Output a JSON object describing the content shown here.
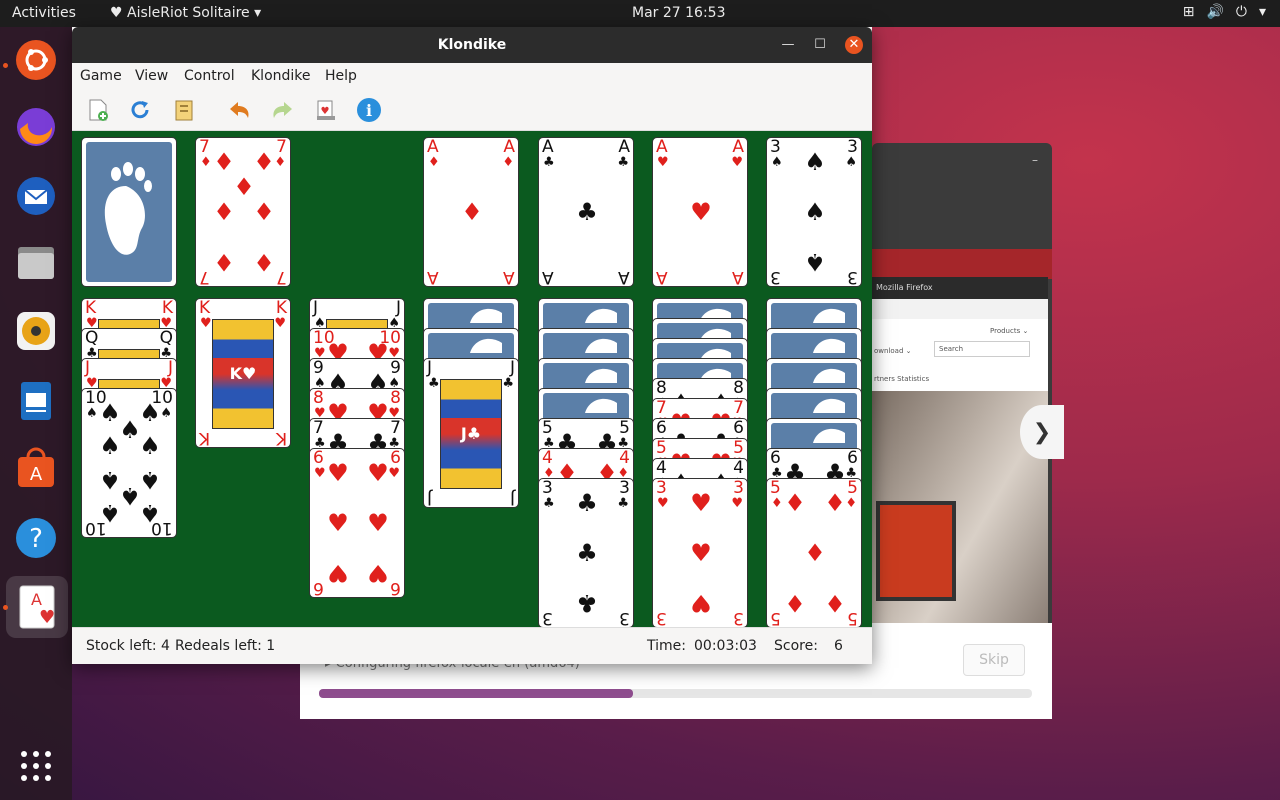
{
  "topbar": {
    "activities": "Activities",
    "app_name": "AisleRiot Solitaire",
    "clock": "Mar 27  16:53"
  },
  "window": {
    "title": "Klondike",
    "menu": [
      "Game",
      "View",
      "Control",
      "Klondike",
      "Help"
    ]
  },
  "statusbar": {
    "stock": "Stock left: 4",
    "redeals": "Redeals left: 1",
    "time_label": "Time:",
    "time_value": "00:03:03",
    "score_label": "Score:",
    "score_value": "6"
  },
  "installer": {
    "status": "▸ Configuring firefox-locale-en (amd64)",
    "skip": "Skip",
    "progress": 0.44
  },
  "firefox_preview": {
    "title": "Mozilla Firefox",
    "products": "Products ⌄",
    "download": "ownload ⌄",
    "search": "Search",
    "links": "rtners   Statistics"
  },
  "cards": {
    "waste": "7♦",
    "foundations": [
      "A♦",
      "A♣",
      "A♥",
      "3♠"
    ],
    "col1": [
      "K♥",
      "Q♣",
      "J♥",
      "10♠"
    ],
    "col2": [
      "K♥"
    ],
    "col3": [
      "J♠",
      "10♥",
      "9♠",
      "8♥",
      "7♣",
      "6♥"
    ],
    "col4": [
      "J♣"
    ],
    "col5": [
      "5♣",
      "4♦",
      "3♣"
    ],
    "col6": [
      "8♠",
      "7♥",
      "6♣",
      "5♥",
      "4♠",
      "3♥"
    ],
    "col7": [
      "6♣",
      "5♦"
    ]
  },
  "colors": {
    "felt": "#0b5a1f",
    "accent": "#e95420",
    "card_red": "#e0201c"
  }
}
